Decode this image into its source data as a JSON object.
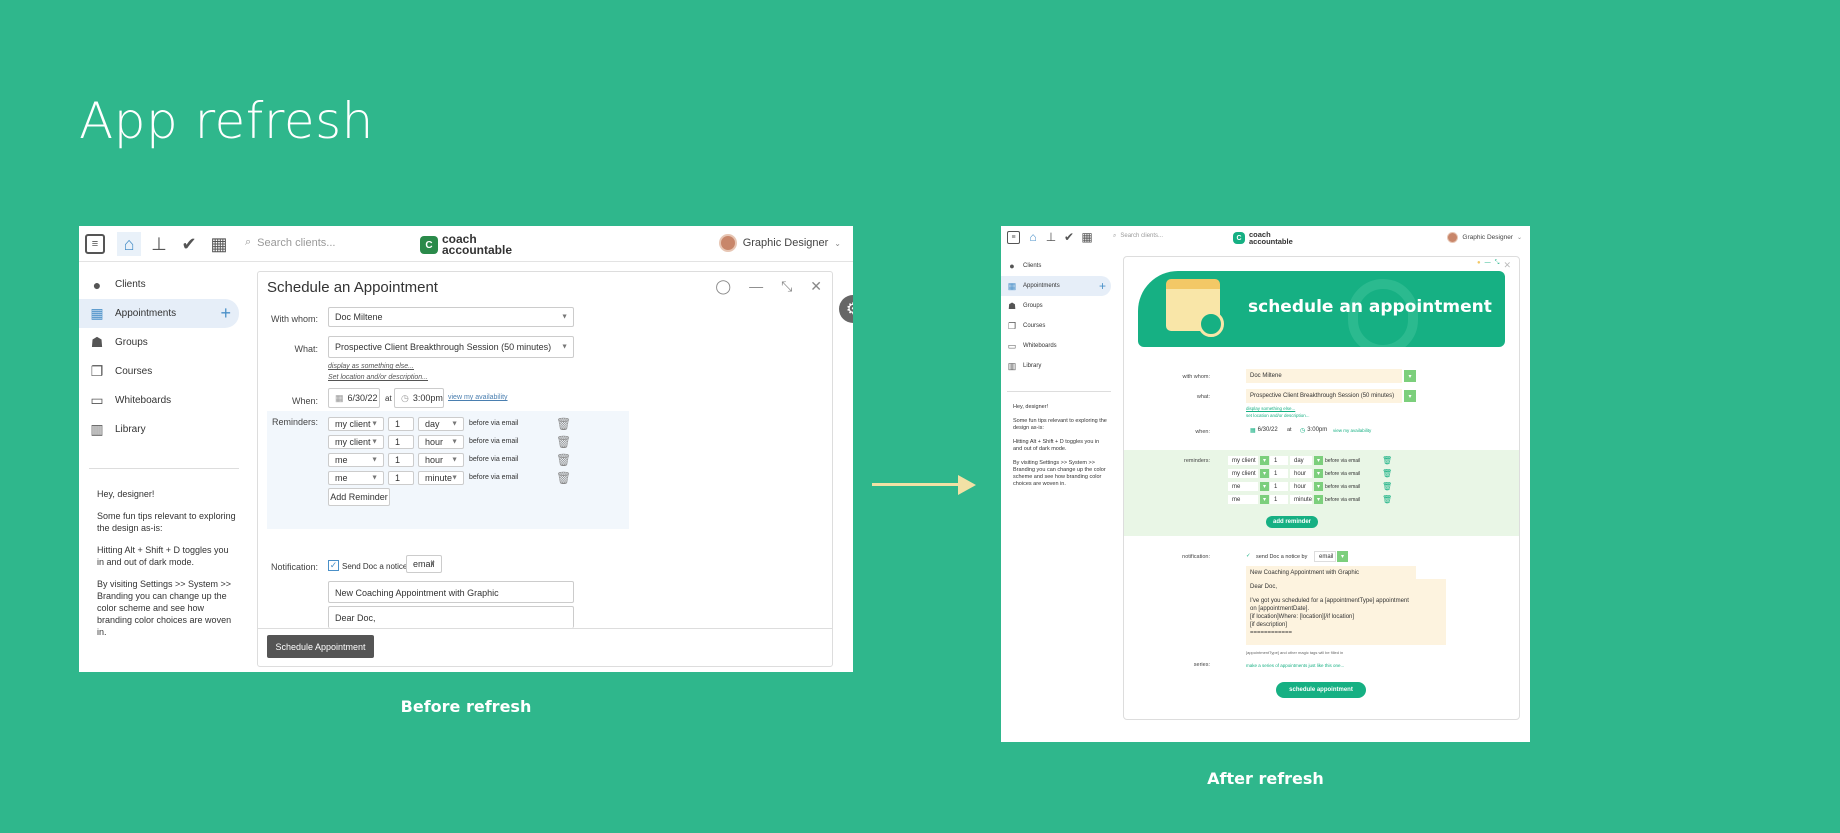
{
  "page": {
    "title": "App refresh",
    "before_caption": "Before refresh",
    "after_caption": "After refresh"
  },
  "before": {
    "search_placeholder": "Search clients...",
    "logo_line1": "coach",
    "logo_line2": "accountable",
    "user": "Graphic Designer",
    "sidebar": [
      "Clients",
      "Appointments",
      "Groups",
      "Courses",
      "Whiteboards",
      "Library"
    ],
    "tips": [
      "Hey, designer!",
      "Some fun tips relevant to exploring the design as-is:",
      "Hitting Alt + Shift + D toggles you in and out of dark mode.",
      "By visiting Settings >> System >> Branding you can change up the color scheme and see how branding color choices are woven in."
    ],
    "dialog_title": "Schedule an Appointment",
    "with_whom_label": "With whom:",
    "with_whom_value": "Doc Miltene",
    "what_label": "What:",
    "what_value": "Prospective Client Breakthrough Session (50 minutes)",
    "display_link": "display as something else...",
    "location_link": "Set location and/or description...",
    "when_label": "When:",
    "date": "6/30/22",
    "at": "at",
    "time": "3:00pm",
    "availability_link": "view my availability",
    "reminders_label": "Reminders:",
    "reminders": [
      {
        "who": "my client",
        "n": "1",
        "unit": "day",
        "via": "before via email"
      },
      {
        "who": "my client",
        "n": "1",
        "unit": "hour",
        "via": "before via email"
      },
      {
        "who": "me",
        "n": "1",
        "unit": "hour",
        "via": "before via email"
      },
      {
        "who": "me",
        "n": "1",
        "unit": "minute",
        "via": "before via email"
      }
    ],
    "add_reminder": "Add Reminder",
    "notification_label": "Notification:",
    "notice_text": "Send Doc a notice by",
    "notice_channel": "email",
    "subject": "New Coaching Appointment with Graphic",
    "body_start": "Dear Doc,",
    "submit": "Schedule Appointment"
  },
  "after": {
    "search_placeholder": "Search clients...",
    "logo_line1": "coach",
    "logo_line2": "accountable",
    "user": "Graphic Designer",
    "sidebar": [
      "Clients",
      "Appointments",
      "Groups",
      "Courses",
      "Whiteboards",
      "Library"
    ],
    "tips": [
      "Hey, designer!",
      "Some fun tips relevant to exploring the design as-is:",
      "Hitting Alt + Shift + D toggles you in and out of dark mode.",
      "By visiting Settings >> System >> Branding you can change up the color scheme and see how branding color choices are woven in."
    ],
    "banner_title": "schedule an appointment",
    "with_whom_label": "with whom:",
    "with_whom_value": "Doc Miltene",
    "what_label": "what:",
    "what_value": "Prospective Client Breakthrough Session (50 minutes)",
    "display_link": "display something else...",
    "location_link": "set location and/or description...",
    "when_label": "when:",
    "date": "6/30/22",
    "at": "at",
    "time": "3:00pm",
    "availability_link": "view my availability",
    "reminders_label": "reminders:",
    "reminders": [
      {
        "who": "my client",
        "n": "1",
        "unit": "day",
        "via": "before via email"
      },
      {
        "who": "my client",
        "n": "1",
        "unit": "hour",
        "via": "before via email"
      },
      {
        "who": "me",
        "n": "1",
        "unit": "hour",
        "via": "before via email"
      },
      {
        "who": "me",
        "n": "1",
        "unit": "minute",
        "via": "before via email"
      }
    ],
    "add_reminder": "add reminder",
    "notification_label": "notification:",
    "notice_text": "send Doc a notice by",
    "notice_channel": "email",
    "subject": "New Coaching Appointment with Graphic",
    "body_lines": [
      "Dear Doc,",
      "",
      "I've got you scheduled for a [appointmentType] appointment",
      "on [appointmentDate].",
      "[if location]Where: [location][/if location]",
      "[if description]",
      "============"
    ],
    "magic_note": "[appointmentType] and other magic tags will be filled in",
    "series_label": "series:",
    "series_link": "make a series of appointments just like this one...",
    "submit": "schedule appointment"
  },
  "colors": {
    "background": "#2fb78c",
    "brand_green": "#16b083",
    "arrow": "#f2e1a5"
  }
}
